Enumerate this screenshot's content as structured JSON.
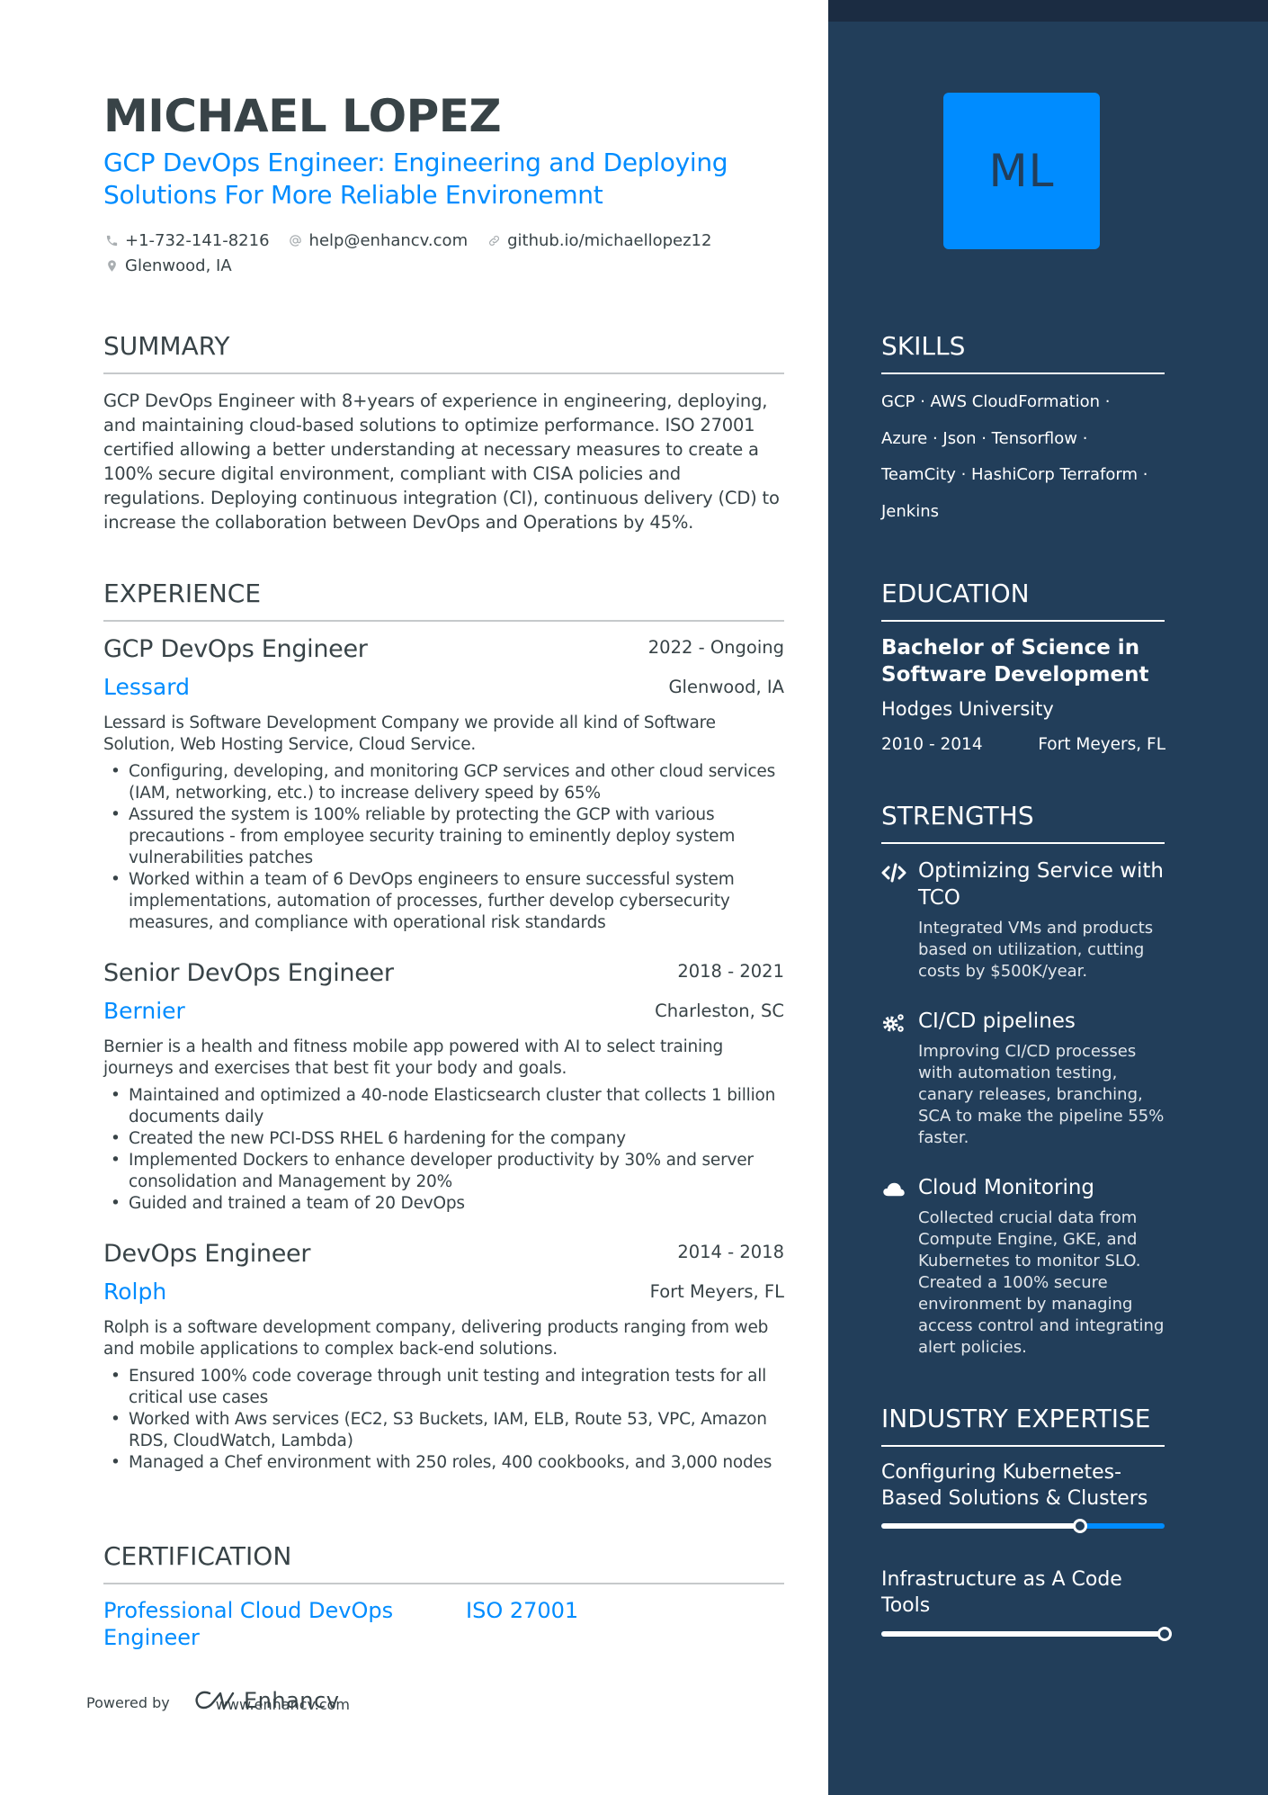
{
  "header": {
    "name": "MICHAEL LOPEZ",
    "headline": "GCP DevOps Engineer: Engineering and Deploying Solutions For More Reliable Environemnt",
    "contacts": {
      "phone": "+1-732-141-8216",
      "email": "help@enhancv.com",
      "link": "github.io/michaellopez12",
      "location": "Glenwood, IA"
    }
  },
  "sections": {
    "summary": "SUMMARY",
    "experience": "EXPERIENCE",
    "certification": "CERTIFICATION",
    "skills": "SKILLS",
    "education": "EDUCATION",
    "strengths": "STRENGTHS",
    "industry_expertise": "INDUSTRY EXPERTISE"
  },
  "summary": "GCP DevOps Engineer with 8+years of experience in engineering, deploying, and maintaining cloud-based solutions to optimize performance. ISO 27001 certified allowing a better understanding at necessary measures to create a 100% secure digital environment, compliant with CISA policies and regulations. Deploying continuous integration (CI), continuous delivery (CD) to increase the collaboration between DevOps and Operations by 45%.",
  "experience": [
    {
      "title": "GCP DevOps Engineer",
      "dates": "2022 - Ongoing",
      "company": "Lessard",
      "location": "Glenwood, IA",
      "description": "Lessard is Software Development Company we provide all kind of Software Solution, Web Hosting Service, Cloud Service.",
      "bullets": [
        "Configuring, developing, and monitoring GCP services and other cloud services (IAM, networking, etc.) to increase delivery speed by 65%",
        "Assured the system is 100% reliable by protecting the GCP with various precautions - from employee security training to eminently deploy system vulnerabilities patches",
        "Worked within a team of 6 DevOps engineers to ensure successful system implementations, automation of processes, further develop cybersecurity measures, and compliance with operational risk standards"
      ]
    },
    {
      "title": "Senior DevOps Engineer",
      "dates": "2018 - 2021",
      "company": "Bernier",
      "location": "Charleston, SC",
      "description": "Bernier is a health and fitness mobile app powered with AI to select training journeys and exercises that best fit your body and goals.",
      "bullets": [
        "Maintained and optimized a 40-node Elasticsearch cluster that collects 1 billion documents daily",
        "Created the new PCI-DSS RHEL 6 hardening for the company",
        "Implemented Dockers to enhance developer productivity by 30% and server consolidation and Management by 20%",
        "Guided and trained a team of 20 DevOps"
      ]
    },
    {
      "title": "DevOps Engineer",
      "dates": "2014 - 2018",
      "company": "Rolph",
      "location": "Fort Meyers, FL",
      "description": "Rolph is a software development company, delivering products ranging from web and mobile applications to complex back-end solutions.",
      "bullets": [
        "Ensured 100% code coverage through unit testing and integration tests for all critical use cases",
        "Worked with Aws services (EC2, S3 Buckets, IAM, ELB, Route 53, VPC, Amazon RDS, CloudWatch, Lambda)",
        "Managed a Chef environment with 250 roles, 400 cookbooks, and 3,000 nodes"
      ]
    }
  ],
  "certifications": [
    "Professional Cloud DevOps Engineer",
    "ISO 27001"
  ],
  "footer": {
    "powered_by": "Powered by",
    "brand": "Enhancv",
    "url": "www.enhancv.com"
  },
  "sidebar": {
    "avatar_initials": "ML",
    "skills_lines": [
      "GCP · AWS CloudFormation ·",
      "Azure · Json · Tensorflow ·",
      "TeamCity · HashiCorp Terraform ·",
      "Jenkins"
    ],
    "education": {
      "degree": "Bachelor of Science in Software Development",
      "school": "Hodges University",
      "dates": "2010 - 2014",
      "location": "Fort Meyers, FL"
    },
    "strengths": [
      {
        "icon": "code-icon",
        "title": "Optimizing Service with TCO",
        "description": "Integrated VMs and products based on utilization, cutting costs by $500K/year."
      },
      {
        "icon": "gears-icon",
        "title": "CI/CD pipelines",
        "description": "Improving CI/CD processes with automation testing, canary releases, branching, SCA to make the pipeline 55% faster."
      },
      {
        "icon": "cloud-icon",
        "title": "Cloud Monitoring",
        "description": "Collected crucial data from Compute Engine, GKE, and Kubernetes to monitor SLO. Created a 100% secure environment by managing access control and integrating alert policies."
      }
    ],
    "industry_expertise": [
      {
        "label": "Configuring Kubernetes-Based Solutions & Clusters",
        "level_percent": 70
      },
      {
        "label": "Infrastructure as A Code Tools",
        "level_percent": 100
      }
    ]
  },
  "colors": {
    "accent": "#008cff",
    "sidebar_bg": "#223e5a",
    "sidebar_top": "#1b2c42",
    "text": "#384347",
    "rule": "#c6c9cb"
  }
}
